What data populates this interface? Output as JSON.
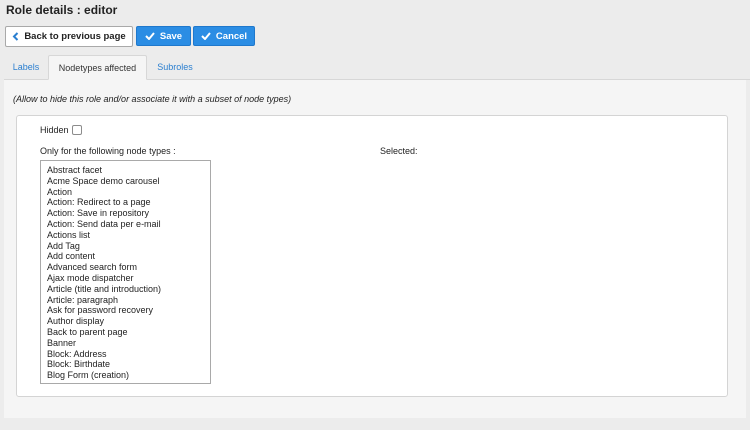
{
  "page": {
    "title": "Role details : editor"
  },
  "toolbar": {
    "back_label": "Back to previous page",
    "save_label": "Save",
    "cancel_label": "Cancel"
  },
  "tabs": [
    {
      "label": "Labels"
    },
    {
      "label": "Nodetypes affected"
    },
    {
      "label": "Subroles"
    }
  ],
  "panel": {
    "hint": "(Allow to hide this role and/or associate it with a subset of node types)",
    "hidden_label": "Hidden",
    "only_label": "Only for the following node types :",
    "selected_label": "Selected:",
    "node_types": [
      "Abstract facet",
      "Acme Space demo carousel",
      "Action",
      "Action: Redirect to a page",
      "Action: Save in repository",
      "Action: Send data per e-mail",
      "Actions list",
      "Add Tag",
      "Add content",
      "Advanced search form",
      "Ajax mode dispatcher",
      "Article (title and introduction)",
      "Article: paragraph",
      "Ask for password recovery",
      "Author display",
      "Back to parent page",
      "Banner",
      "Block: Address",
      "Block: Birthdate",
      "Blog Form (creation)"
    ]
  },
  "icons": {
    "back": "chevron-left-icon",
    "save": "check-icon",
    "cancel": "check-icon"
  }
}
